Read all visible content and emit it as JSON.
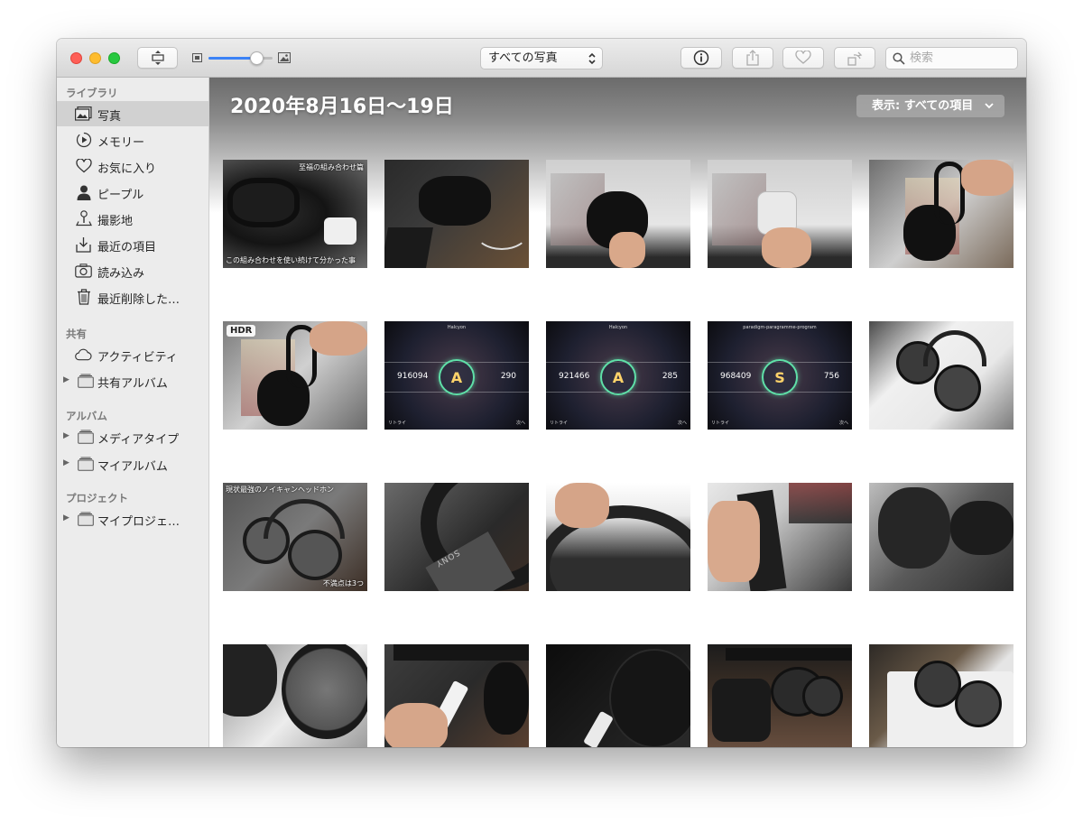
{
  "toolbar": {
    "view_select": "すべての写真",
    "search_placeholder": "検索",
    "zoom_level": 0.72
  },
  "sidebar": {
    "sections": [
      {
        "title": "ライブラリ"
      },
      {
        "title": "共有"
      },
      {
        "title": "アルバム"
      },
      {
        "title": "プロジェクト"
      }
    ],
    "library": [
      {
        "label": "写真",
        "icon": "photos-icon",
        "selected": true
      },
      {
        "label": "メモリー",
        "icon": "memories-icon"
      },
      {
        "label": "お気に入り",
        "icon": "heart-icon"
      },
      {
        "label": "ピープル",
        "icon": "person-icon"
      },
      {
        "label": "撮影地",
        "icon": "location-pin-icon"
      },
      {
        "label": "最近の項目",
        "icon": "import-arrow-icon"
      },
      {
        "label": "読み込み",
        "icon": "camera-icon"
      },
      {
        "label": "最近削除した…",
        "icon": "trash-icon"
      }
    ],
    "shared": [
      {
        "label": "アクティビティ",
        "icon": "cloud-icon"
      },
      {
        "label": "共有アルバム",
        "icon": "folder-icon"
      }
    ],
    "albums": [
      {
        "label": "メディアタイプ",
        "icon": "folder-icon"
      },
      {
        "label": "マイアルバム",
        "icon": "folder-icon"
      }
    ],
    "projects": [
      {
        "label": "マイプロジェ…",
        "icon": "folder-icon"
      }
    ]
  },
  "main": {
    "date_title": "2020年8月16日〜19日",
    "filter_label": "表示: すべての項目"
  },
  "photos": [
    {
      "caption_top": "至福の組み合わせ篇",
      "caption_bottom": "この組み合わせを使い続けて分かった事"
    },
    {},
    {},
    {},
    {},
    {
      "badge": "HDR"
    },
    {
      "song": "Halcyon",
      "grade": "A",
      "score_left": "916094",
      "score_right": "290",
      "retry": "リトライ",
      "next": "次へ"
    },
    {
      "song": "Halcyon",
      "grade": "A",
      "score_left": "921466",
      "score_right": "285",
      "retry": "リトライ",
      "next": "次へ"
    },
    {
      "song": "paradigm-paragramme-program",
      "grade": "S",
      "score_left": "968409",
      "score_right": "756",
      "retry": "リトライ",
      "next": "次へ"
    },
    {},
    {
      "caption_top": "現状最強のノイキャンヘッドホン",
      "caption_bottom": "不満点は3つ"
    },
    {
      "logo": "SONY"
    },
    {},
    {},
    {},
    {},
    {},
    {},
    {},
    {}
  ]
}
